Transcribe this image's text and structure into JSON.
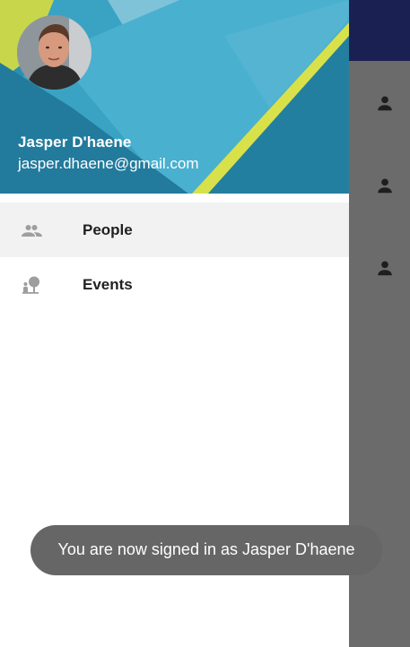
{
  "drawer": {
    "header": {
      "user_name": "Jasper D'haene",
      "user_email": "jasper.dhaene@gmail.com"
    },
    "items": [
      {
        "label": "People",
        "icon": "people-icon",
        "selected": true
      },
      {
        "label": "Events",
        "icon": "events-icon",
        "selected": false
      }
    ]
  },
  "background_list": {
    "icons": [
      "person-icon",
      "person-icon",
      "person-icon"
    ]
  },
  "toast": {
    "message": "You are now signed in as Jasper D'haene"
  },
  "colors": {
    "toolbar": "#1a2152",
    "scrim": "#6b6b6b",
    "selected_row": "#f2f2f2",
    "toast": "#666666"
  }
}
